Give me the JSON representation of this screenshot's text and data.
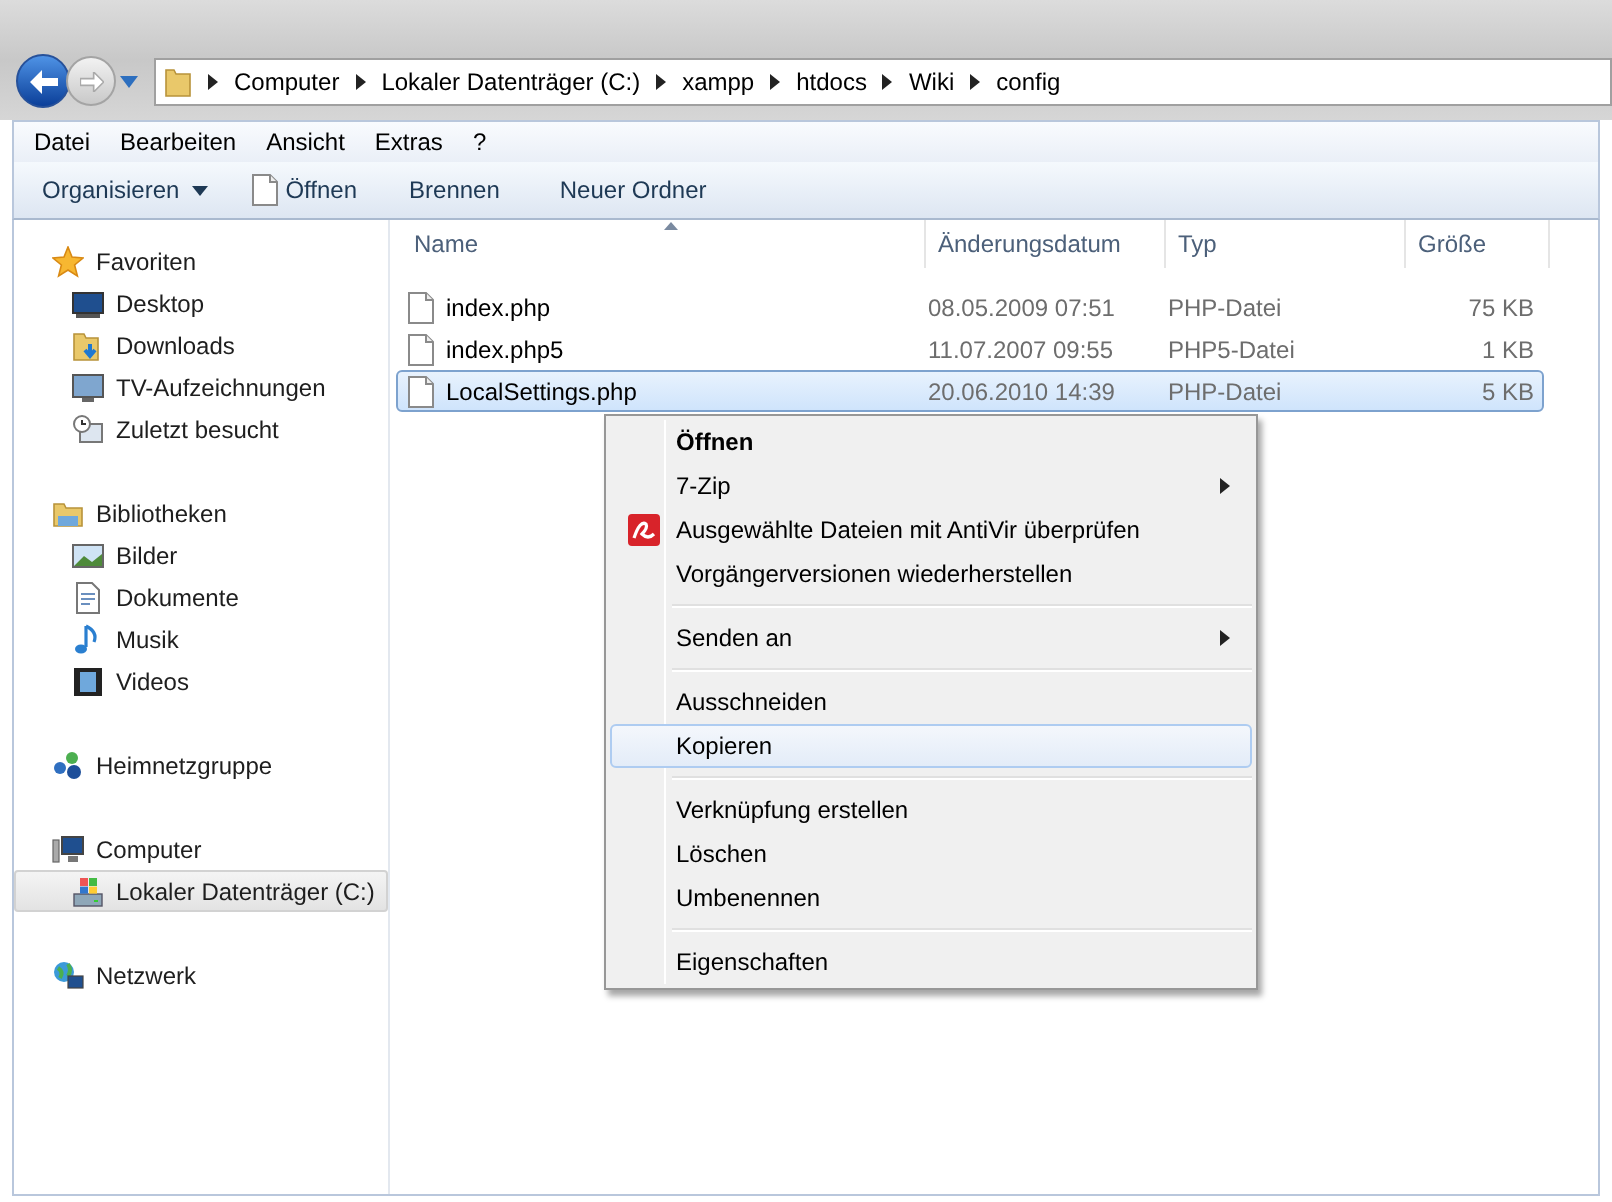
{
  "breadcrumb": [
    "Computer",
    "Lokaler Datenträger (C:)",
    "xampp",
    "htdocs",
    "Wiki",
    "config"
  ],
  "menu_bar": [
    "Datei",
    "Bearbeiten",
    "Ansicht",
    "Extras",
    "?"
  ],
  "toolbar": [
    {
      "label": "Organisieren",
      "kind": "dropdown"
    },
    {
      "label": "Öffnen",
      "kind": "open"
    },
    {
      "label": "Brennen",
      "kind": "plain"
    },
    {
      "label": "Neuer Ordner",
      "kind": "plain"
    }
  ],
  "sidebar": [
    {
      "label": "Favoriten",
      "kind": "star",
      "selected": false,
      "children": [
        {
          "label": "Desktop",
          "kind": "desktop",
          "selected": false
        },
        {
          "label": "Downloads",
          "kind": "downloads",
          "selected": false
        },
        {
          "label": "TV-Aufzeichnungen",
          "kind": "tv",
          "selected": false
        },
        {
          "label": "Zuletzt besucht",
          "kind": "recent",
          "selected": false
        }
      ]
    },
    {
      "label": "Bibliotheken",
      "kind": "library",
      "selected": false,
      "children": [
        {
          "label": "Bilder",
          "kind": "pictures",
          "selected": false
        },
        {
          "label": "Dokumente",
          "kind": "documents",
          "selected": false
        },
        {
          "label": "Musik",
          "kind": "music",
          "selected": false
        },
        {
          "label": "Videos",
          "kind": "videos",
          "selected": false
        }
      ]
    },
    {
      "label": "Heimnetzgruppe",
      "kind": "homegroup",
      "selected": false
    },
    {
      "label": "Computer",
      "kind": "computer",
      "selected": false,
      "children": [
        {
          "label": "Lokaler Datenträger (C:)",
          "kind": "drive",
          "selected": true
        }
      ]
    },
    {
      "label": "Netzwerk",
      "kind": "network",
      "selected": false
    }
  ],
  "columns": [
    {
      "label": "Name",
      "sorted": true
    },
    {
      "label": "Änderungsdatum",
      "sorted": false
    },
    {
      "label": "Typ",
      "sorted": false
    },
    {
      "label": "Größe",
      "sorted": false
    }
  ],
  "files": [
    {
      "name": "index.php",
      "date": "08.05.2009 07:51",
      "type": "PHP-Datei",
      "size": "75 KB",
      "selected": false
    },
    {
      "name": "index.php5",
      "date": "11.07.2007 09:55",
      "type": "PHP5-Datei",
      "size": "1 KB",
      "selected": false
    },
    {
      "name": "LocalSettings.php",
      "date": "20.06.2010 14:39",
      "type": "PHP-Datei",
      "size": "5 KB",
      "selected": true
    }
  ],
  "context_menu": [
    {
      "kind": "item",
      "label": "Öffnen",
      "default": true,
      "submenu": false,
      "antivir": false,
      "selected": false
    },
    {
      "kind": "item",
      "label": "7-Zip",
      "default": false,
      "submenu": true,
      "antivir": false,
      "selected": false
    },
    {
      "kind": "item",
      "label": "Ausgewählte Dateien mit AntiVir überprüfen",
      "default": false,
      "submenu": false,
      "antivir": true,
      "selected": false
    },
    {
      "kind": "item",
      "label": "Vorgängerversionen wiederherstellen",
      "default": false,
      "submenu": false,
      "antivir": false,
      "selected": false
    },
    {
      "kind": "separator"
    },
    {
      "kind": "item",
      "label": "Senden an",
      "default": false,
      "submenu": true,
      "antivir": false,
      "selected": false
    },
    {
      "kind": "separator"
    },
    {
      "kind": "item",
      "label": "Ausschneiden",
      "default": false,
      "submenu": false,
      "antivir": false,
      "selected": false
    },
    {
      "kind": "item",
      "label": "Kopieren",
      "default": false,
      "submenu": false,
      "antivir": false,
      "selected": true
    },
    {
      "kind": "separator"
    },
    {
      "kind": "item",
      "label": "Verknüpfung erstellen",
      "default": false,
      "submenu": false,
      "antivir": false,
      "selected": false
    },
    {
      "kind": "item",
      "label": "Löschen",
      "default": false,
      "submenu": false,
      "antivir": false,
      "selected": false
    },
    {
      "kind": "item",
      "label": "Umbenennen",
      "default": false,
      "submenu": false,
      "antivir": false,
      "selected": false
    },
    {
      "kind": "separator"
    },
    {
      "kind": "item",
      "label": "Eigenschaften",
      "default": false,
      "submenu": false,
      "antivir": false,
      "selected": false
    }
  ]
}
